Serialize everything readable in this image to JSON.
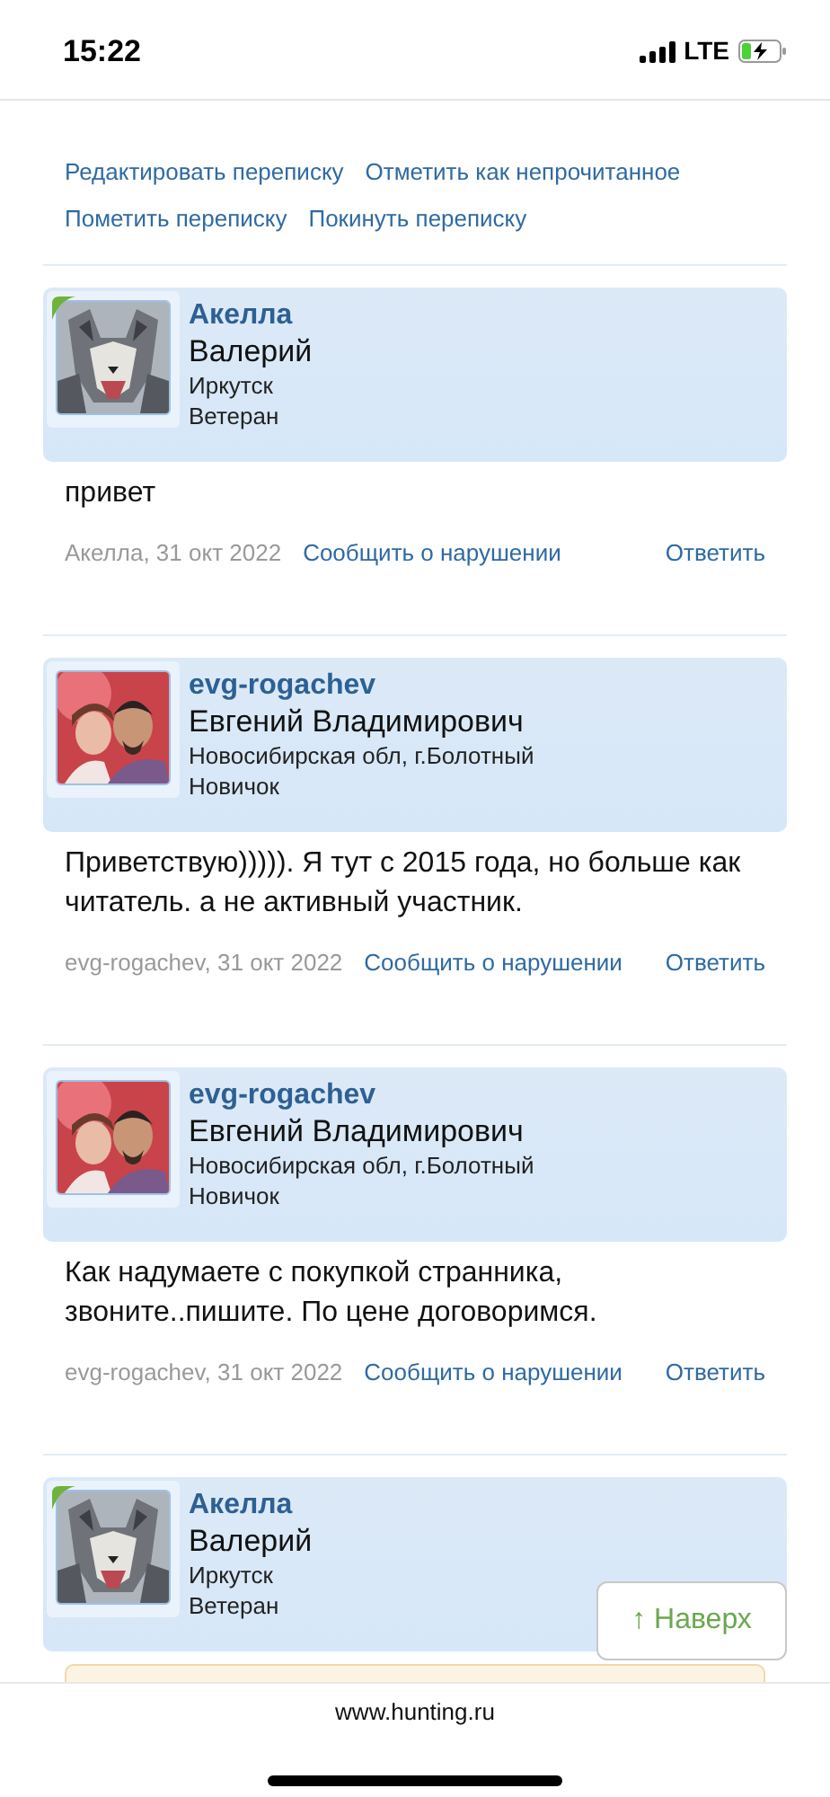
{
  "status_bar": {
    "time": "15:22",
    "network": "LTE"
  },
  "actions": [
    {
      "label": "Редактировать переписку"
    },
    {
      "label": "Отметить как непрочитанное"
    },
    {
      "label": "Пометить переписку"
    },
    {
      "label": "Покинуть переписку"
    }
  ],
  "posts": [
    {
      "username": "Акелла",
      "full_name": "Валерий",
      "location": "Иркутск",
      "rank": "Ветеран",
      "online": true,
      "text": "привет",
      "meta": "Акелла, 31 окт 2022",
      "report": "Сообщить о нарушении",
      "reply": "Ответить"
    },
    {
      "username": "evg-rogachev",
      "full_name": "Евгений Владимирович",
      "location": "Новосибирская обл, г.Болотный",
      "rank": "Новичок",
      "online": false,
      "text": "Приветствую))))). Я тут с 2015 года, но больше как читатель. а не активный участник.",
      "meta": "evg-rogachev, 31 окт 2022",
      "report": "Сообщить о нарушении",
      "reply": "Ответить"
    },
    {
      "username": "evg-rogachev",
      "full_name": "Евгений Владимирович",
      "location": "Новосибирская обл, г.Болотный",
      "rank": "Новичок",
      "online": false,
      "text": "Как надумаете с покупкой странника, звоните..пишите. По цене договоримся.",
      "meta": "evg-rogachev, 31 окт 2022",
      "report": "Сообщить о нарушении",
      "reply": "Ответить"
    },
    {
      "username": "Акелла",
      "full_name": "Валерий",
      "location": "Иркутск",
      "rank": "Ветеран",
      "online": true
    }
  ],
  "scroll_top_button": {
    "label": "↑ Наверх"
  },
  "browser_bar": {
    "url": "www.hunting.ru"
  }
}
